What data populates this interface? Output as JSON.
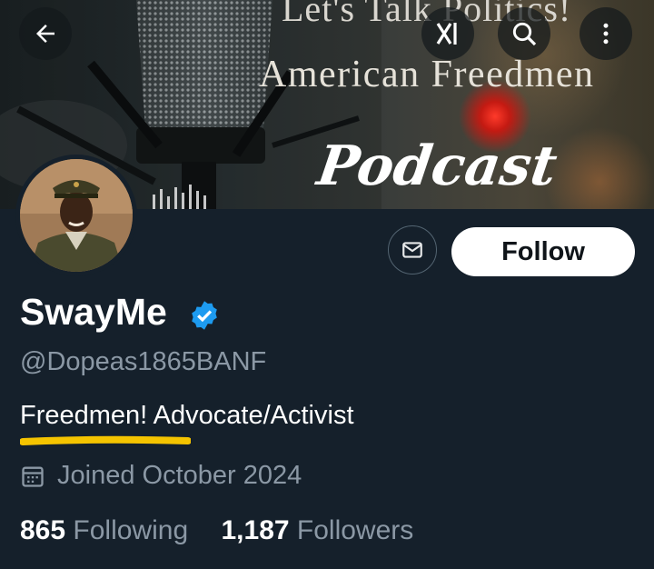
{
  "banner": {
    "line1": "Let's Talk Politics!",
    "line2": "American Freedmen",
    "line3": "Podcast"
  },
  "toolbar": {
    "back_icon": "arrow-left-icon",
    "grok_icon": "grok-icon",
    "search_icon": "search-icon",
    "more_icon": "more-vertical-icon"
  },
  "profile": {
    "display_name": "SwayMe",
    "handle": "@Dopeas1865BANF",
    "bio": "Freedmen! Advocate/Activist",
    "joined": "Joined October 2024",
    "follow_label": "Follow",
    "following_count": "865",
    "following_label": "Following",
    "followers_count": "1,187",
    "followers_label": "Followers"
  },
  "colors": {
    "background": "#15202b",
    "verified": "#1d9bf0",
    "muted": "#8b98a5",
    "highlight": "#f5c400"
  }
}
